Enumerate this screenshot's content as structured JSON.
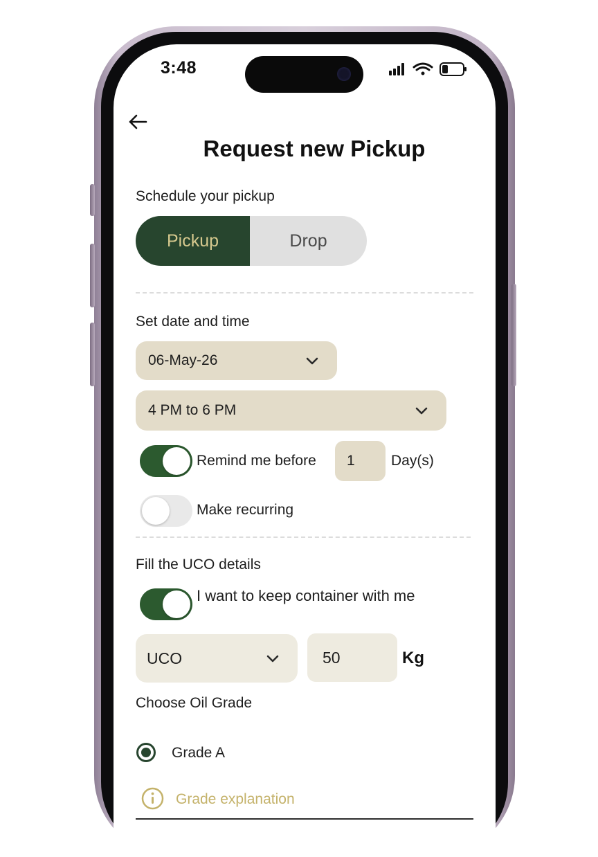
{
  "status_bar": {
    "time": "3:48"
  },
  "header": {
    "title": "Request new Pickup"
  },
  "schedule": {
    "label": "Schedule your pickup",
    "options": [
      "Pickup",
      "Drop"
    ],
    "selected": "Pickup"
  },
  "datetime": {
    "label": "Set date and time",
    "date_value": "06-May-26",
    "time_value": "4 PM to 6 PM",
    "reminder": {
      "enabled": true,
      "label": "Remind me before",
      "value": "1",
      "unit": "Day(s)"
    },
    "recurring": {
      "enabled": false,
      "label": "Make recurring"
    }
  },
  "uco": {
    "label": "Fill the UCO details",
    "keep_container": {
      "enabled": true,
      "label": "I want to keep container with me"
    },
    "type_value": "UCO",
    "quantity": "50",
    "unit": "Kg"
  },
  "grade": {
    "label": "Choose Oil Grade",
    "selected_option": "Grade A",
    "explanation_link": "Grade explanation"
  },
  "colors": {
    "primary_green": "#27452e",
    "toggle_green": "#2c5a2f",
    "beige": "#e3dcc9",
    "light_beige": "#eeebe0",
    "gold_text": "#c4b26a"
  }
}
